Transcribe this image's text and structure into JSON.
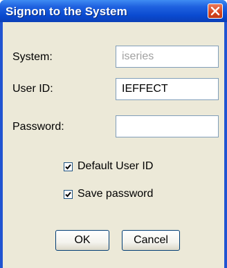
{
  "window": {
    "title": "Signon to the System"
  },
  "form": {
    "system": {
      "label": "System:",
      "value": "iseries"
    },
    "user_id": {
      "label": "User ID:",
      "value": "IEFFECT"
    },
    "password": {
      "label": "Password:",
      "value": ""
    }
  },
  "options": {
    "default_user_id": {
      "label": "Default User ID",
      "checked": true
    },
    "save_password": {
      "label": "Save password",
      "checked": true
    }
  },
  "buttons": {
    "ok_label": "OK",
    "cancel_label": "Cancel"
  },
  "icons": {
    "close": "close-icon",
    "check": "checkmark-icon"
  },
  "colors": {
    "title_bar": "#0a4ad0",
    "dialog_background": "#ece9d8",
    "close_button": "#d5441f",
    "disabled_text": "#a0a0a0"
  }
}
